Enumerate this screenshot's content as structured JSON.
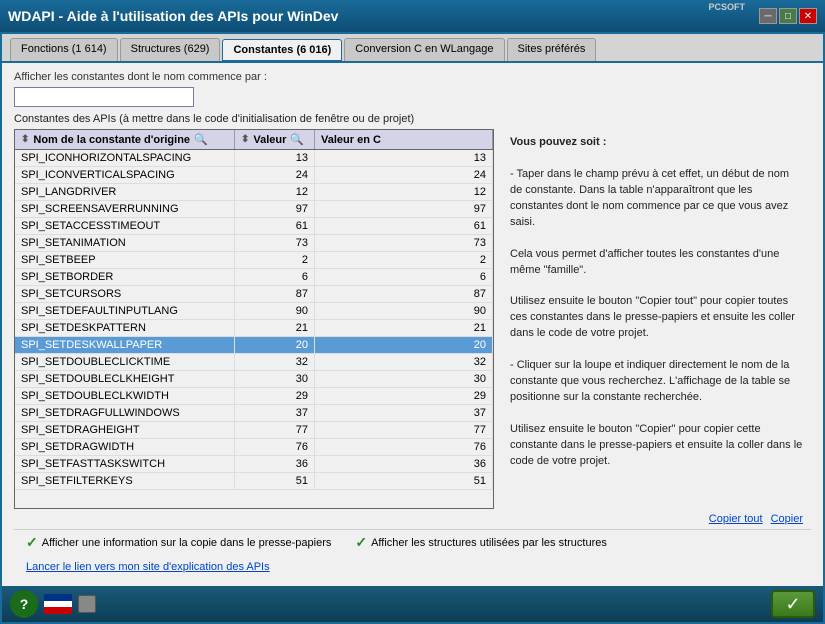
{
  "titlebar": {
    "logo": "PCSOFT",
    "title": "WDAPI - Aide à l'utilisation des APIs pour WinDev",
    "btn_minimize": "─",
    "btn_maximize": "□",
    "btn_close": "✕"
  },
  "tabs": [
    {
      "id": "fonctions",
      "label": "Fonctions (1 614)",
      "active": false
    },
    {
      "id": "structures",
      "label": "Structures (629)",
      "active": false
    },
    {
      "id": "constantes",
      "label": "Constantes (6 016)",
      "active": true
    },
    {
      "id": "conversion",
      "label": "Conversion C en WLangage",
      "active": false
    },
    {
      "id": "sites",
      "label": "Sites préférés",
      "active": false
    }
  ],
  "search": {
    "label": "Afficher les constantes dont le nom commence par :",
    "value": "",
    "placeholder": ""
  },
  "table": {
    "section_label": "Constantes des APIs (à mettre dans le code d'initialisation de fenêtre ou de projet)",
    "headers": [
      {
        "id": "name",
        "label": "Nom de la constante d'origine"
      },
      {
        "id": "value",
        "label": "Valeur"
      },
      {
        "id": "valuec",
        "label": "Valeur en C"
      }
    ],
    "rows": [
      {
        "name": "SPI_ICONHORIZONTALSPACING",
        "value": "13",
        "valuec": "13",
        "selected": false
      },
      {
        "name": "SPI_ICONVERTICALSPACING",
        "value": "24",
        "valuec": "24",
        "selected": false
      },
      {
        "name": "SPI_LANGDRIVER",
        "value": "12",
        "valuec": "12",
        "selected": false
      },
      {
        "name": "SPI_SCREENSAVERRUNNING",
        "value": "97",
        "valuec": "97",
        "selected": false
      },
      {
        "name": "SPI_SETACCESSTIMEOUT",
        "value": "61",
        "valuec": "61",
        "selected": false
      },
      {
        "name": "SPI_SETANIMATION",
        "value": "73",
        "valuec": "73",
        "selected": false
      },
      {
        "name": "SPI_SETBEEP",
        "value": "2",
        "valuec": "2",
        "selected": false
      },
      {
        "name": "SPI_SETBORDER",
        "value": "6",
        "valuec": "6",
        "selected": false
      },
      {
        "name": "SPI_SETCURSORS",
        "value": "87",
        "valuec": "87",
        "selected": false
      },
      {
        "name": "SPI_SETDEFAULTINPUTLANG",
        "value": "90",
        "valuec": "90",
        "selected": false
      },
      {
        "name": "SPI_SETDESKPATTERN",
        "value": "21",
        "valuec": "21",
        "selected": false
      },
      {
        "name": "SPI_SETDESKWALLPAPER",
        "value": "20",
        "valuec": "20",
        "selected": true
      },
      {
        "name": "SPI_SETDOUBLECLICKTIME",
        "value": "32",
        "valuec": "32",
        "selected": false
      },
      {
        "name": "SPI_SETDOUBLECLKHEIGHT",
        "value": "30",
        "valuec": "30",
        "selected": false
      },
      {
        "name": "SPI_SETDOUBLECLKWIDTH",
        "value": "29",
        "valuec": "29",
        "selected": false
      },
      {
        "name": "SPI_SETDRAGFULLWINDOWS",
        "value": "37",
        "valuec": "37",
        "selected": false
      },
      {
        "name": "SPI_SETDRAGHEIGHT",
        "value": "77",
        "valuec": "77",
        "selected": false
      },
      {
        "name": "SPI_SETDRAGWIDTH",
        "value": "76",
        "valuec": "76",
        "selected": false
      },
      {
        "name": "SPI_SETFASTTASKSWITCH",
        "value": "36",
        "valuec": "36",
        "selected": false
      },
      {
        "name": "SPI_SETFILTERKEYS",
        "value": "51",
        "valuec": "51",
        "selected": false
      }
    ]
  },
  "help": {
    "text": "Vous pouvez soit :\n\n- Taper dans le champ prévu à cet effet, un début de nom de constante. Dans la table n'apparaîtront que les constantes dont le nom commence par ce que vous avez saisi.\n\nCela vous permet d'afficher toutes les constantes d'une même \"famille\".\n\nUtilisez ensuite le bouton \"Copier tout\" pour copier toutes ces constantes dans le presse-papiers et ensuite les coller dans le code de votre projet.\n\n- Cliquer sur la loupe et indiquer directement le nom de la constante que vous recherchez. L'affichage de la table se positionne sur la constante recherchée.\n\nUtilisez ensuite le bouton \"Copier\" pour copier cette constante dans le presse-papiers et ensuite la coller dans le code de votre projet."
  },
  "actions": {
    "copy_all": "Copier tout",
    "copy": "Copier"
  },
  "checkboxes": {
    "checkbox1_label": "Afficher une information sur la copie dans le presse-papiers",
    "checkbox2_label": "Afficher les structures utilisées par les structures",
    "checkbox1_checked": true,
    "checkbox2_checked": true
  },
  "link": {
    "label": "Lancer le lien vers mon site d'explication des APIs"
  },
  "bottom": {
    "help_btn": "?",
    "ok_btn": "✓"
  }
}
